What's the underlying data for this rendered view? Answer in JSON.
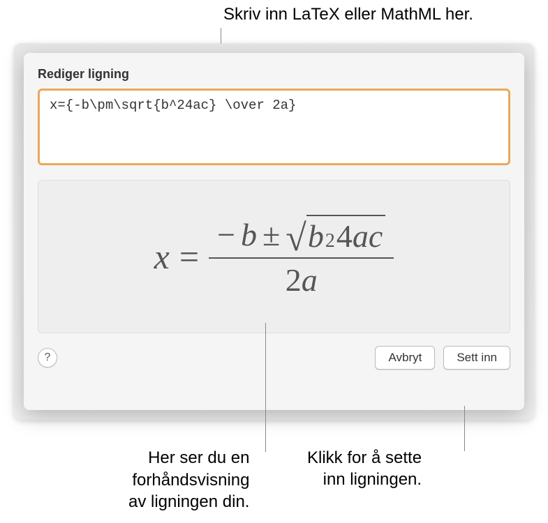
{
  "callouts": {
    "top": "Skriv inn LaTeX eller MathML her.",
    "bottom_left_line1": "Her ser du en",
    "bottom_left_line2": "forhåndsvisning",
    "bottom_left_line3": "av ligningen din.",
    "bottom_right_line1": "Klikk for å sette",
    "bottom_right_line2": "inn ligningen."
  },
  "dialog": {
    "title": "Rediger ligning",
    "input_value": "x={-b\\pm\\sqrt{b^24ac} \\over 2a}",
    "help_label": "?",
    "cancel_label": "Avbryt",
    "insert_label": "Sett inn"
  },
  "equation": {
    "x": "x",
    "equals": "=",
    "minus": "−",
    "b": "b",
    "pm": "±",
    "sup2": "2",
    "four": "4",
    "a": "a",
    "c": "c",
    "two": "2",
    "a2": "a"
  }
}
